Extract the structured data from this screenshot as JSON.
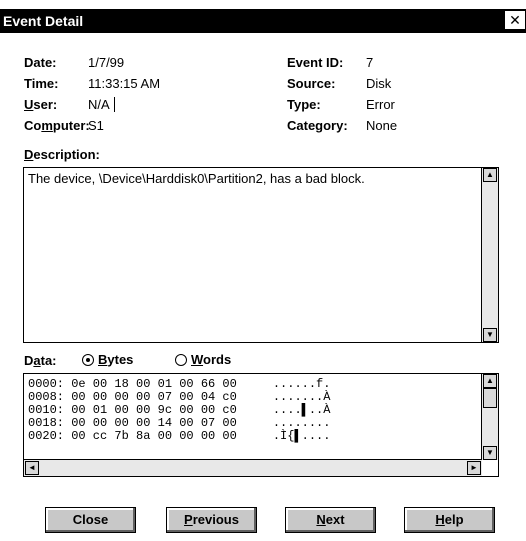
{
  "window": {
    "title": "Event Detail",
    "close_glyph": "✕"
  },
  "fields": {
    "date_label": "Date:",
    "date_value": "1/7/99",
    "time_label": "Time:",
    "time_value": "11:33:15 AM",
    "user_label_u": "U",
    "user_label_rest": "ser:",
    "user_value": "N/A",
    "computer_label_pre": "Co",
    "computer_label_u": "m",
    "computer_label_rest": "puter:",
    "computer_value": "S1",
    "eventid_label": "Event ID:",
    "eventid_value": "7",
    "source_label": "Source:",
    "source_value": "Disk",
    "type_label": "Type:",
    "type_value": "Error",
    "category_label": "Category:",
    "category_value": "None"
  },
  "description": {
    "label_u": "D",
    "label_rest": "escription:",
    "text": "The device, \\Device\\Harddisk0\\Partition2, has a bad block."
  },
  "data": {
    "label_pre": "D",
    "label_u": "a",
    "label_rest": "ta:",
    "bytes_u": "B",
    "bytes_rest": "ytes",
    "words_u": "W",
    "words_rest": "ords",
    "selected": "Bytes",
    "lines": [
      "0000: 0e 00 18 00 01 00 66 00     ......f.",
      "0008: 00 00 00 00 07 00 04 c0     .......À",
      "0010: 00 01 00 00 9c 00 00 c0     ....▌..À",
      "0018: 00 00 00 00 14 00 07 00     ........",
      "0020: 00 cc 7b 8a 00 00 00 00     .Ì{▌...."
    ]
  },
  "buttons": {
    "close": "Close",
    "previous_u": "P",
    "previous_rest": "revious",
    "next_u": "N",
    "next_rest": "ext",
    "help_u": "H",
    "help_rest": "elp"
  },
  "scroll_arrows": {
    "up": "▲",
    "down": "▼",
    "left": "◄",
    "right": "►"
  }
}
